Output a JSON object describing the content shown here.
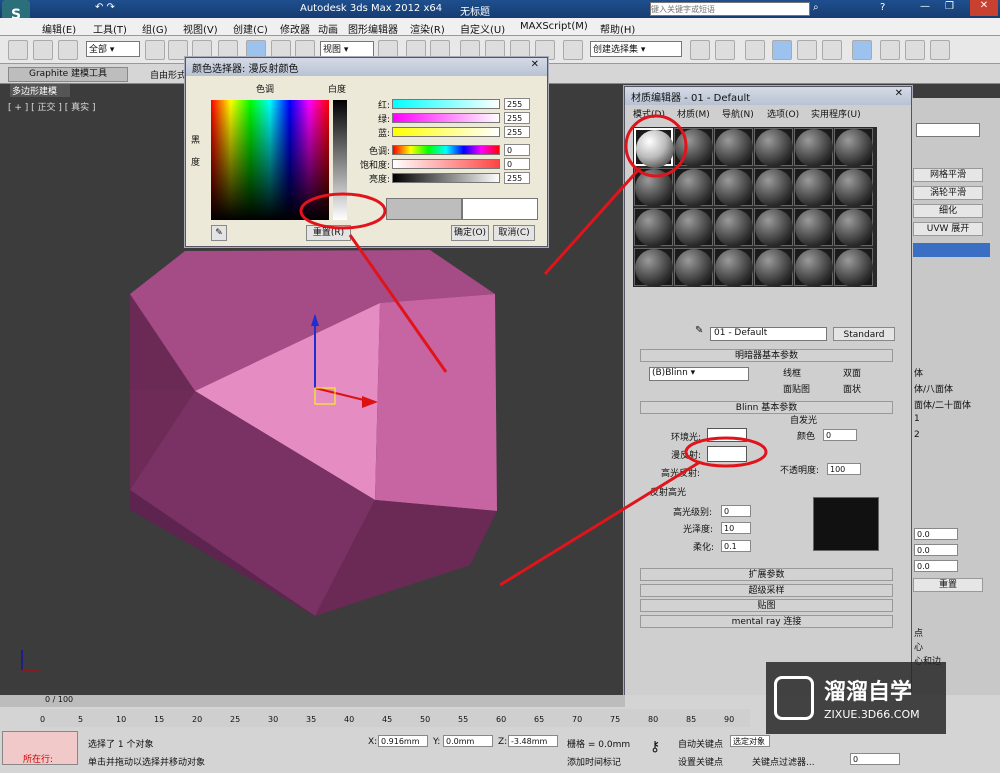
{
  "window": {
    "title": "Autodesk 3ds Max  2012 x64",
    "doc": "无标题",
    "search_placeholder": "键入关键字或短语"
  },
  "menu": [
    "编辑(E)",
    "工具(T)",
    "组(G)",
    "视图(V)",
    "创建(C)",
    "修改器",
    "动画",
    "图形编辑器",
    "渲染(R)",
    "自定义(U)",
    "MAXScript(M)",
    "帮助(H)"
  ],
  "toolbar": {
    "selection_filter": "全部",
    "view_select": "视图",
    "named_selection": "创建选择集"
  },
  "ribbon": {
    "tab1": "Graphite 建模工具",
    "tab2": "自由形式",
    "sub": "多边形建模"
  },
  "viewport": {
    "label": "[ + ] [ 正交 ] [ 真实 ]"
  },
  "color_picker": {
    "title": "颜色选择器: 漫反射颜色",
    "hue_label": "色调",
    "white_label": "白度",
    "black_label": "黑",
    "degree_label": "度",
    "channels": [
      {
        "name": "红:",
        "value": "255"
      },
      {
        "name": "绿:",
        "value": "255"
      },
      {
        "name": "蓝:",
        "value": "255"
      },
      {
        "name": "色调:",
        "value": "0"
      },
      {
        "name": "饱和度:",
        "value": "0"
      },
      {
        "name": "亮度:",
        "value": "255"
      }
    ],
    "reset": "重置(R)",
    "ok": "确定(O)",
    "cancel": "取消(C)"
  },
  "material_editor": {
    "title": "材质编辑器 - 01 - Default",
    "menu": [
      "模式(D)",
      "材质(M)",
      "导航(N)",
      "选项(O)",
      "实用程序(U)"
    ],
    "material_name": "01 - Default",
    "type": "Standard",
    "shader_rollout": "明暗器基本参数",
    "shader": "(B)Blinn",
    "checks": [
      "线框",
      "双面",
      "面贴图",
      "面状"
    ],
    "blinn_rollout": "Blinn 基本参数",
    "ambient": "环境光:",
    "diffuse": "漫反射:",
    "specular": "高光反射:",
    "self_illum": "自发光",
    "color_label": "颜色",
    "self_illum_value": "0",
    "opacity_label": "不透明度:",
    "opacity": "100",
    "spec_group": "反射高光",
    "spec_level_label": "高光级别:",
    "spec_level": "0",
    "gloss_label": "光泽度:",
    "gloss": "10",
    "soften_label": "柔化:",
    "soften": "0.1",
    "rollouts": [
      "扩展参数",
      "超级采样",
      "贴图",
      "mental ray 连接"
    ]
  },
  "right_panel": {
    "buttons": [
      "网格平滑",
      "涡轮平滑",
      "细化",
      "UVW 展开"
    ],
    "list": [
      "体",
      "体/八面体",
      "面体/二十面体",
      "1",
      "2"
    ],
    "values": [
      "0.0",
      "0.0",
      "0.0"
    ],
    "reset": "重置",
    "extra": [
      "点",
      "心",
      "心和边"
    ]
  },
  "timeline": {
    "frame": "0 / 100",
    "ticks": [
      "0",
      "5",
      "10",
      "15",
      "20",
      "25",
      "30",
      "35",
      "40",
      "45",
      "50",
      "55",
      "60",
      "65",
      "70",
      "75",
      "80",
      "85",
      "90"
    ]
  },
  "status": {
    "mode": "所在行:",
    "msg1": "选择了 1 个对象",
    "msg2": "单击并拖动以选择并移动对象",
    "x": "0.916mm",
    "y": "0.0mm",
    "z": "-3.48mm",
    "grid": "栅格 = 0.0mm",
    "add_time_tag": "添加时间标记",
    "auto_key": "自动关键点",
    "set_key": "设置关键点",
    "selected": "选定对象",
    "key_filter": "关键点过滤器...",
    "frame_spin": "0"
  },
  "watermark": {
    "brand": "溜溜自学",
    "url": "ZIXUE.3D66.COM"
  },
  "colors": {
    "pink_light": "#e58cc2",
    "pink_mid": "#a54b85",
    "pink_dark": "#6b2a55",
    "annotation_red": "#e0141a"
  }
}
